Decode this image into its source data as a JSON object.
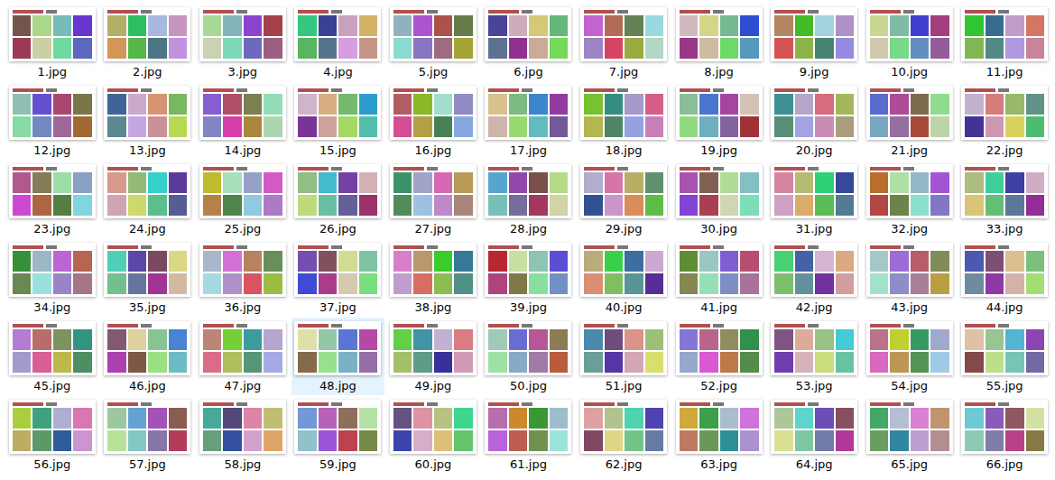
{
  "file_grid": {
    "items": [
      {
        "label": "1.jpg",
        "selected": false
      },
      {
        "label": "2.jpg",
        "selected": false
      },
      {
        "label": "3.jpg",
        "selected": false
      },
      {
        "label": "4.jpg",
        "selected": false
      },
      {
        "label": "5.jpg",
        "selected": false
      },
      {
        "label": "6.jpg",
        "selected": false
      },
      {
        "label": "7.jpg",
        "selected": false
      },
      {
        "label": "8.jpg",
        "selected": false
      },
      {
        "label": "9.jpg",
        "selected": false
      },
      {
        "label": "10.jpg",
        "selected": false
      },
      {
        "label": "11.jpg",
        "selected": false
      },
      {
        "label": "12.jpg",
        "selected": false
      },
      {
        "label": "13.jpg",
        "selected": false
      },
      {
        "label": "14.jpg",
        "selected": false
      },
      {
        "label": "15.jpg",
        "selected": false
      },
      {
        "label": "16.jpg",
        "selected": false
      },
      {
        "label": "17.jpg",
        "selected": false
      },
      {
        "label": "18.jpg",
        "selected": false
      },
      {
        "label": "19.jpg",
        "selected": false
      },
      {
        "label": "20.jpg",
        "selected": false
      },
      {
        "label": "21.jpg",
        "selected": false
      },
      {
        "label": "22.jpg",
        "selected": false
      },
      {
        "label": "23.jpg",
        "selected": false
      },
      {
        "label": "24.jpg",
        "selected": false
      },
      {
        "label": "25.jpg",
        "selected": false
      },
      {
        "label": "26.jpg",
        "selected": false
      },
      {
        "label": "27.jpg",
        "selected": false
      },
      {
        "label": "28.jpg",
        "selected": false
      },
      {
        "label": "29.jpg",
        "selected": false
      },
      {
        "label": "30.jpg",
        "selected": false
      },
      {
        "label": "31.jpg",
        "selected": false
      },
      {
        "label": "32.jpg",
        "selected": false
      },
      {
        "label": "33.jpg",
        "selected": false
      },
      {
        "label": "34.jpg",
        "selected": false
      },
      {
        "label": "35.jpg",
        "selected": false
      },
      {
        "label": "36.jpg",
        "selected": false
      },
      {
        "label": "37.jpg",
        "selected": false
      },
      {
        "label": "38.jpg",
        "selected": false
      },
      {
        "label": "39.jpg",
        "selected": false
      },
      {
        "label": "40.jpg",
        "selected": false
      },
      {
        "label": "41.jpg",
        "selected": false
      },
      {
        "label": "42.jpg",
        "selected": false
      },
      {
        "label": "43.jpg",
        "selected": false
      },
      {
        "label": "44.jpg",
        "selected": false
      },
      {
        "label": "45.jpg",
        "selected": false
      },
      {
        "label": "46.jpg",
        "selected": false
      },
      {
        "label": "47.jpg",
        "selected": false
      },
      {
        "label": "48.jpg",
        "selected": true
      },
      {
        "label": "49.jpg",
        "selected": false
      },
      {
        "label": "50.jpg",
        "selected": false
      },
      {
        "label": "51.jpg",
        "selected": false
      },
      {
        "label": "52.jpg",
        "selected": false
      },
      {
        "label": "53.jpg",
        "selected": false
      },
      {
        "label": "54.jpg",
        "selected": false
      },
      {
        "label": "55.jpg",
        "selected": false
      },
      {
        "label": "56.jpg",
        "selected": false
      },
      {
        "label": "57.jpg",
        "selected": false
      },
      {
        "label": "58.jpg",
        "selected": false
      },
      {
        "label": "59.jpg",
        "selected": false
      },
      {
        "label": "60.jpg",
        "selected": false
      },
      {
        "label": "61.jpg",
        "selected": false
      },
      {
        "label": "62.jpg",
        "selected": false
      },
      {
        "label": "63.jpg",
        "selected": false
      },
      {
        "label": "64.jpg",
        "selected": false
      },
      {
        "label": "65.jpg",
        "selected": false
      },
      {
        "label": "66.jpg",
        "selected": false
      }
    ]
  }
}
